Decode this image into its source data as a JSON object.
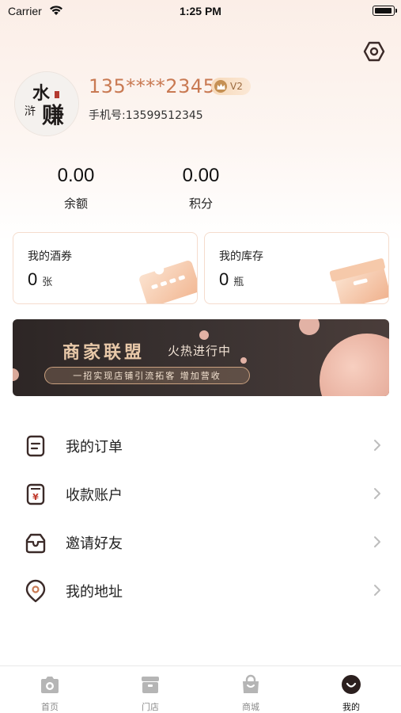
{
  "status_bar": {
    "carrier": "Carrier",
    "time": "1:25 PM"
  },
  "profile": {
    "username": "135****2345",
    "vip_level": "V2",
    "phone": "手机号:13599512345",
    "avatar_text": "水浒赚"
  },
  "stats": [
    {
      "value": "0.00",
      "label": "余额"
    },
    {
      "value": "0.00",
      "label": "积分"
    }
  ],
  "cards": [
    {
      "title": "我的酒券",
      "count": "0",
      "unit": "张"
    },
    {
      "title": "我的库存",
      "count": "0",
      "unit": "瓶"
    }
  ],
  "banner": {
    "title": "商家联盟",
    "subtitle": "火热进行中",
    "tagline": "一招实现店铺引流拓客 增加营收"
  },
  "menu": [
    {
      "label": "我的订单",
      "icon": "order-icon"
    },
    {
      "label": "收款账户",
      "icon": "wallet-yuan-icon"
    },
    {
      "label": "邀请好友",
      "icon": "invite-icon"
    },
    {
      "label": "我的地址",
      "icon": "location-icon"
    }
  ],
  "tabs": [
    {
      "label": "首页",
      "icon": "camera-home-icon",
      "active": false
    },
    {
      "label": "门店",
      "icon": "store-icon",
      "active": false
    },
    {
      "label": "商城",
      "icon": "shopping-bag-icon",
      "active": false
    },
    {
      "label": "我的",
      "icon": "profile-smile-icon",
      "active": true
    }
  ],
  "colors": {
    "accent": "#c97a53",
    "vip_badge": "#f7d9b9",
    "banner_gold": "#e9c9a9",
    "banner_bg": "#2d2625",
    "icon_dark": "#3b2a28",
    "tab_inactive": "#b5b5b5"
  }
}
